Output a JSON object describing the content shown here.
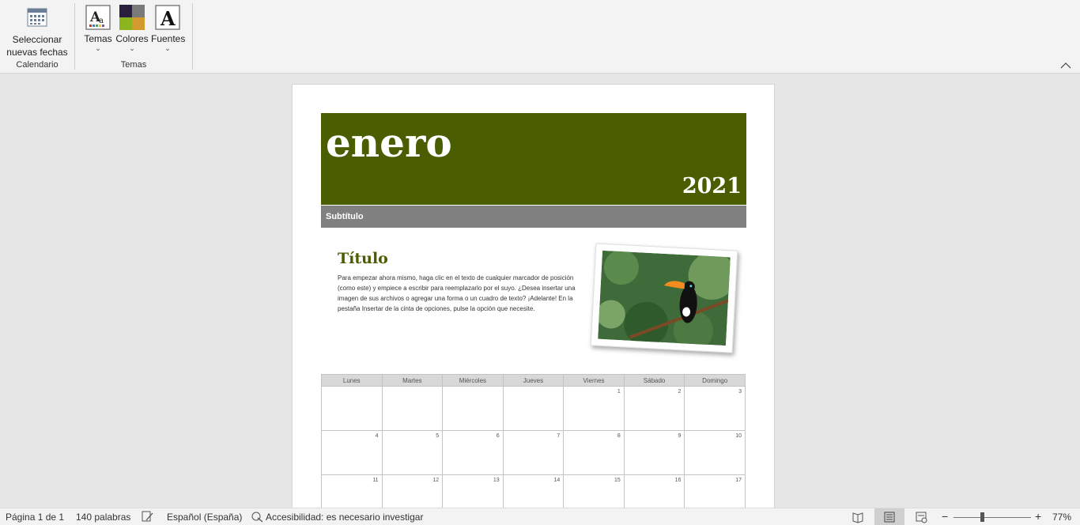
{
  "ribbon": {
    "groups": [
      {
        "label": "Calendario",
        "buttons": [
          {
            "label_line1": "Seleccionar",
            "label_line2": "nuevas fechas",
            "icon": "calendar-icon"
          }
        ]
      },
      {
        "label": "Temas",
        "buttons": [
          {
            "label": "Temas",
            "icon": "themes-icon"
          },
          {
            "label": "Colores",
            "icon": "colors-icon"
          },
          {
            "label": "Fuentes",
            "icon": "fonts-icon"
          }
        ]
      }
    ]
  },
  "document": {
    "month": "enero",
    "year": "2021",
    "subtitle": "Subtítulo",
    "title": "Título",
    "body": "Para empezar ahora mismo, haga clic en el texto de cualquier marcador de posición (como este) y empiece a escribir para reemplazarlo por el suyo. ¿Desea insertar una imagen de sus archivos o agregar una forma o un cuadro de texto? ¡Adelante! En la pestaña Insertar de la cinta de opciones, pulse la opción que necesite.",
    "banner_color": "#4a5d00",
    "calendar": {
      "days": [
        "Lunes",
        "Martes",
        "Miércoles",
        "Jueves",
        "Viernes",
        "Sábado",
        "Domingo"
      ],
      "weeks": [
        [
          "",
          "",
          "",
          "",
          "1",
          "2",
          "3"
        ],
        [
          "4",
          "5",
          "6",
          "7",
          "8",
          "9",
          "10"
        ],
        [
          "11",
          "12",
          "13",
          "14",
          "15",
          "16",
          "17"
        ]
      ]
    }
  },
  "status": {
    "page": "Página 1 de 1",
    "words": "140 palabras",
    "language": "Español (España)",
    "accessibility": "Accesibilidad: es necesario investigar",
    "zoom": "77%"
  }
}
